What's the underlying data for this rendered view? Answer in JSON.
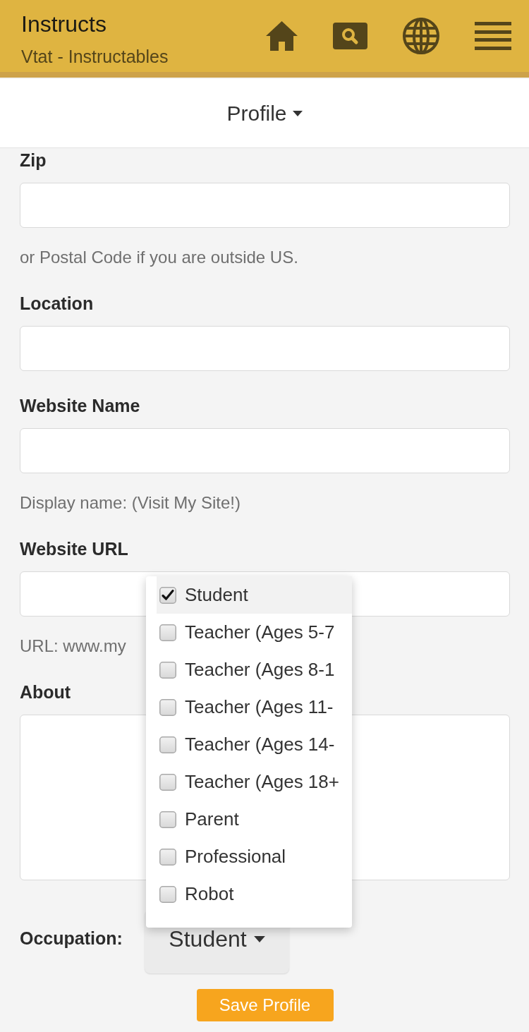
{
  "header": {
    "title": "Instructs",
    "subtitle": "Vtat - Instructables"
  },
  "section_menu": {
    "label": "Profile"
  },
  "fields": [
    {
      "kind": "input",
      "label": "Zip",
      "help": "or Postal Code if you are outside US."
    },
    {
      "kind": "input",
      "label": "Location"
    },
    {
      "kind": "input",
      "label": "Website Name",
      "help": "Display name: (Visit My Site!)"
    },
    {
      "kind": "input",
      "label": "Website URL",
      "help": "URL: www.my"
    },
    {
      "kind": "textarea",
      "label": "About"
    }
  ],
  "occupation": {
    "label": "Occupation:",
    "value": "Student",
    "options": [
      {
        "label": "Student",
        "checked": true,
        "selected": true
      },
      {
        "label": "Teacher (Ages 5-7",
        "checked": false,
        "selected": false
      },
      {
        "label": "Teacher (Ages 8-1",
        "checked": false,
        "selected": false
      },
      {
        "label": "Teacher (Ages 11-",
        "checked": false,
        "selected": false
      },
      {
        "label": "Teacher (Ages 14-",
        "checked": false,
        "selected": false
      },
      {
        "label": "Teacher (Ages 18+",
        "checked": false,
        "selected": false
      },
      {
        "label": "Parent",
        "checked": false,
        "selected": false
      },
      {
        "label": "Professional",
        "checked": false,
        "selected": false
      },
      {
        "label": "Robot",
        "checked": false,
        "selected": false
      }
    ]
  },
  "save_button": {
    "label": "Save Profile"
  }
}
